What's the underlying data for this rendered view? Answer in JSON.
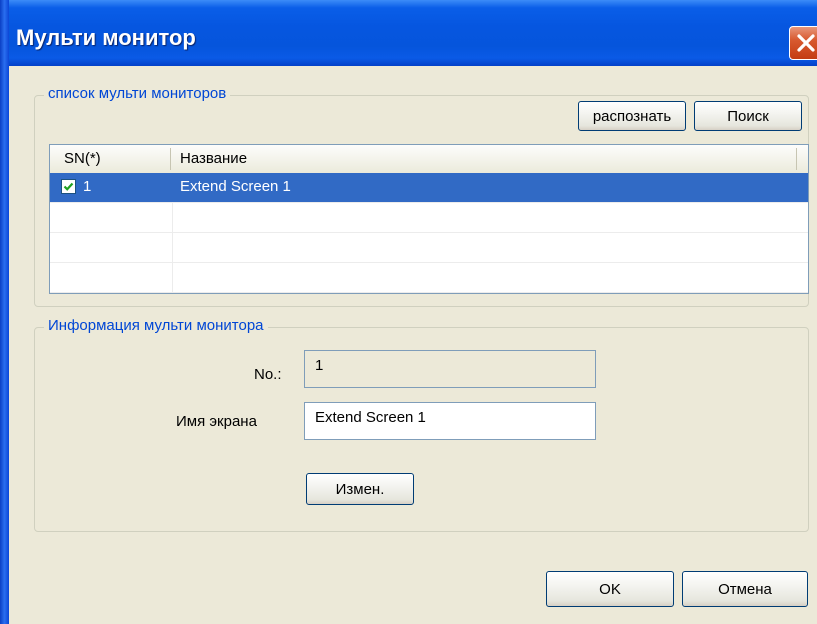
{
  "window": {
    "title": "Мульти монитор"
  },
  "monitor_list": {
    "group_title": "список мульти мониторов",
    "detect_button": "распознать",
    "search_button": "Поиск",
    "columns": [
      "SN(*)",
      "Название"
    ],
    "rows": [
      {
        "sn": "1",
        "name": "Extend Screen 1",
        "checked": true,
        "selected": true
      }
    ]
  },
  "monitor_info": {
    "group_title": "Информация мульти монитора",
    "no_label": "No.:",
    "no_value": "1",
    "screen_name_label": "Имя экрана",
    "screen_name_value": "Extend Screen 1",
    "change_button": "Измен."
  },
  "footer": {
    "ok_button": "OK",
    "cancel_button": "Отмена"
  },
  "colors": {
    "title_bar": "#0a5ee8",
    "selection": "#316ac5",
    "group_title": "#0046d5",
    "dialog_bg": "#ece9d8"
  },
  "icons": [
    "close-icon",
    "checkmark-icon"
  ]
}
